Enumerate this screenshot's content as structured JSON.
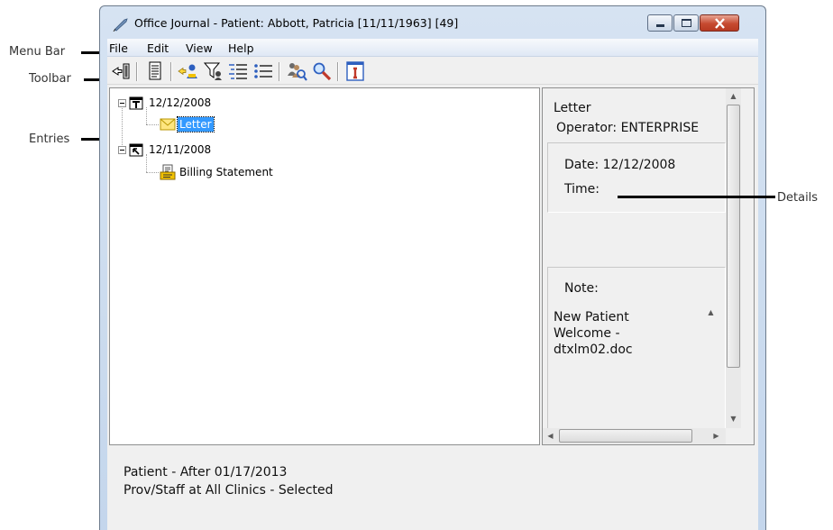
{
  "annotations": {
    "menu_bar": "Menu Bar",
    "toolbar": "Toolbar",
    "entries": "Entries",
    "details": "Details"
  },
  "window": {
    "title": "Office Journal - Patient: Abbott, Patricia  [11/11/1963] [49]",
    "app_icon": "quill-pen-icon",
    "controls": [
      "minimize-icon",
      "maximize-icon",
      "close-icon"
    ]
  },
  "menubar": {
    "items": [
      "File",
      "Edit",
      "View",
      "Help"
    ]
  },
  "toolbar": {
    "buttons": [
      {
        "name": "exit-icon"
      },
      {
        "name": "document-icon"
      },
      {
        "name": "select-patient-icon"
      },
      {
        "name": "filter-icon"
      },
      {
        "name": "expand-all-icon"
      },
      {
        "name": "collapse-all-icon"
      },
      {
        "name": "search-people-icon"
      },
      {
        "name": "magnifier-icon"
      },
      {
        "name": "info-icon"
      }
    ]
  },
  "tree": {
    "groups": [
      {
        "date": "12/12/2008",
        "icon": "calendar-t-icon",
        "entries": [
          {
            "label": "Letter",
            "icon": "envelope-icon",
            "selected": true
          }
        ]
      },
      {
        "date": "12/11/2008",
        "icon": "calendar-arrow-icon",
        "entries": [
          {
            "label": "Billing Statement",
            "icon": "billing-statement-icon",
            "selected": false
          }
        ]
      }
    ]
  },
  "details": {
    "type": "Letter",
    "operator": "Operator: ENTERPRISE",
    "date": "Date:  12/12/2008",
    "time": "Time:",
    "note_label": "Note:",
    "note_lines": [
      "New Patient",
      "Welcome -",
      "dtxlm02.doc"
    ]
  },
  "status": {
    "line1": "Patient - After 01/17/2013",
    "line2": "Prov/Staff at All Clinics - Selected"
  },
  "colors": {
    "selection": "#3399ff",
    "close_button": "#c64a30",
    "window_frame": "#c4d6ec"
  }
}
